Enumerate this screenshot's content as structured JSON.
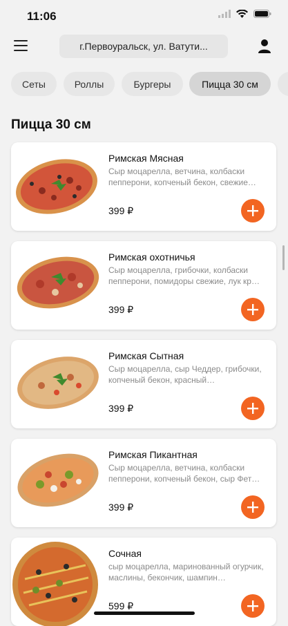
{
  "status_bar": {
    "time": "11:06"
  },
  "header": {
    "address": "г.Первоуральск, ул. Ватути..."
  },
  "categories": [
    "Сеты",
    "Роллы",
    "Бургеры",
    "Пицца 30 см"
  ],
  "section": {
    "title": "Пицца 30 см"
  },
  "products": [
    {
      "name": "Римская Мясная",
      "description": "Сыр моцарелла, ветчина, колбаски пепперони, копченый бекон, свежие…",
      "price": "399 ₽"
    },
    {
      "name": "Римская охотничья",
      "description": "Сыр моцарелла, грибочки, колбаски пепперони, помидоры свежие, лук кр…",
      "price": "399 ₽"
    },
    {
      "name": "Римская  Сытная",
      "description": "Сыр моцарелла, сыр Чеддер, грибочки, копченый бекон, красный…",
      "price": "399 ₽"
    },
    {
      "name": "Римская Пикантная",
      "description": "Сыр моцарелла, ветчина, колбаски пепперони, копченый бекон, сыр Фет…",
      "price": "399 ₽"
    },
    {
      "name": "Сочная",
      "description": "сыр моцарелла, маринованный огурчик, маслины, бекончик, шампин…",
      "price": "599 ₽"
    }
  ],
  "accent_color": "#f26522"
}
